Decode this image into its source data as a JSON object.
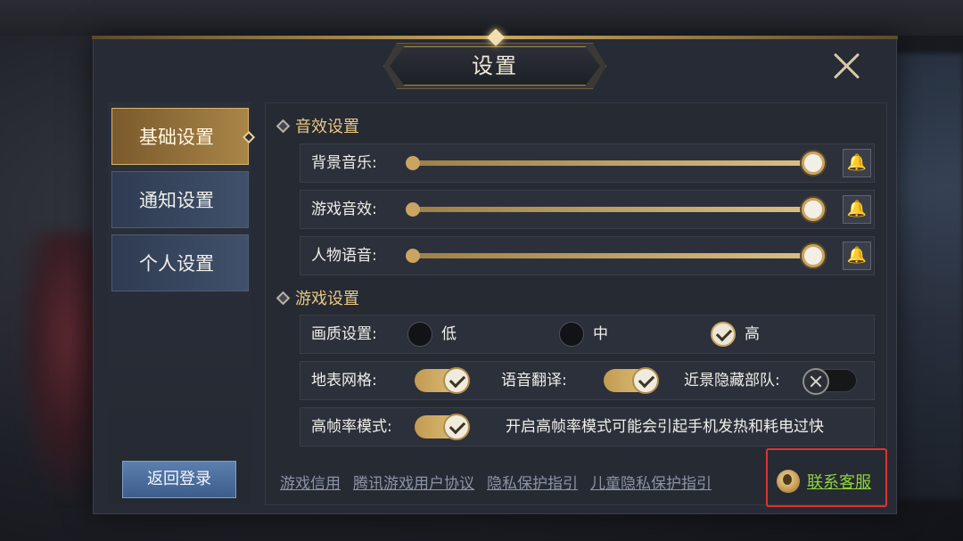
{
  "dialog": {
    "title": "设置"
  },
  "sidebar": {
    "tabs": [
      {
        "label": "基础设置",
        "active": true
      },
      {
        "label": "通知设置",
        "active": false
      },
      {
        "label": "个人设置",
        "active": false
      }
    ],
    "back_label": "返回登录"
  },
  "sound": {
    "title": "音效设置",
    "rows": [
      {
        "label": "背景音乐:",
        "value": 1.0,
        "icon": "bell-icon"
      },
      {
        "label": "游戏音效:",
        "value": 1.0,
        "icon": "bell-icon"
      },
      {
        "label": "人物语音:",
        "value": 1.0,
        "icon": "bell-icon"
      }
    ]
  },
  "game": {
    "title": "游戏设置",
    "quality": {
      "label": "画质设置:",
      "options": [
        {
          "label": "低",
          "selected": false
        },
        {
          "label": "中",
          "selected": false
        },
        {
          "label": "高",
          "selected": true
        }
      ]
    },
    "terrain_grid": {
      "label": "地表网格:",
      "on": true
    },
    "voice_translate": {
      "label": "语音翻译:",
      "on": true
    },
    "hide_near_troops": {
      "label": "近景隐藏部队:",
      "on": false
    },
    "high_fps": {
      "label": "高帧率模式:",
      "on": true,
      "note": "开启高帧率模式可能会引起手机发热和耗电过快"
    }
  },
  "footer": {
    "links": [
      "游戏信用",
      "腾讯游戏用户协议",
      "隐私保护指引",
      "儿童隐私保护指引"
    ],
    "customer_service": "联系客服"
  },
  "colors": {
    "accent_gold": "#c9a463",
    "highlight_red": "#e0322f",
    "cs_green": "#8ed23e"
  }
}
